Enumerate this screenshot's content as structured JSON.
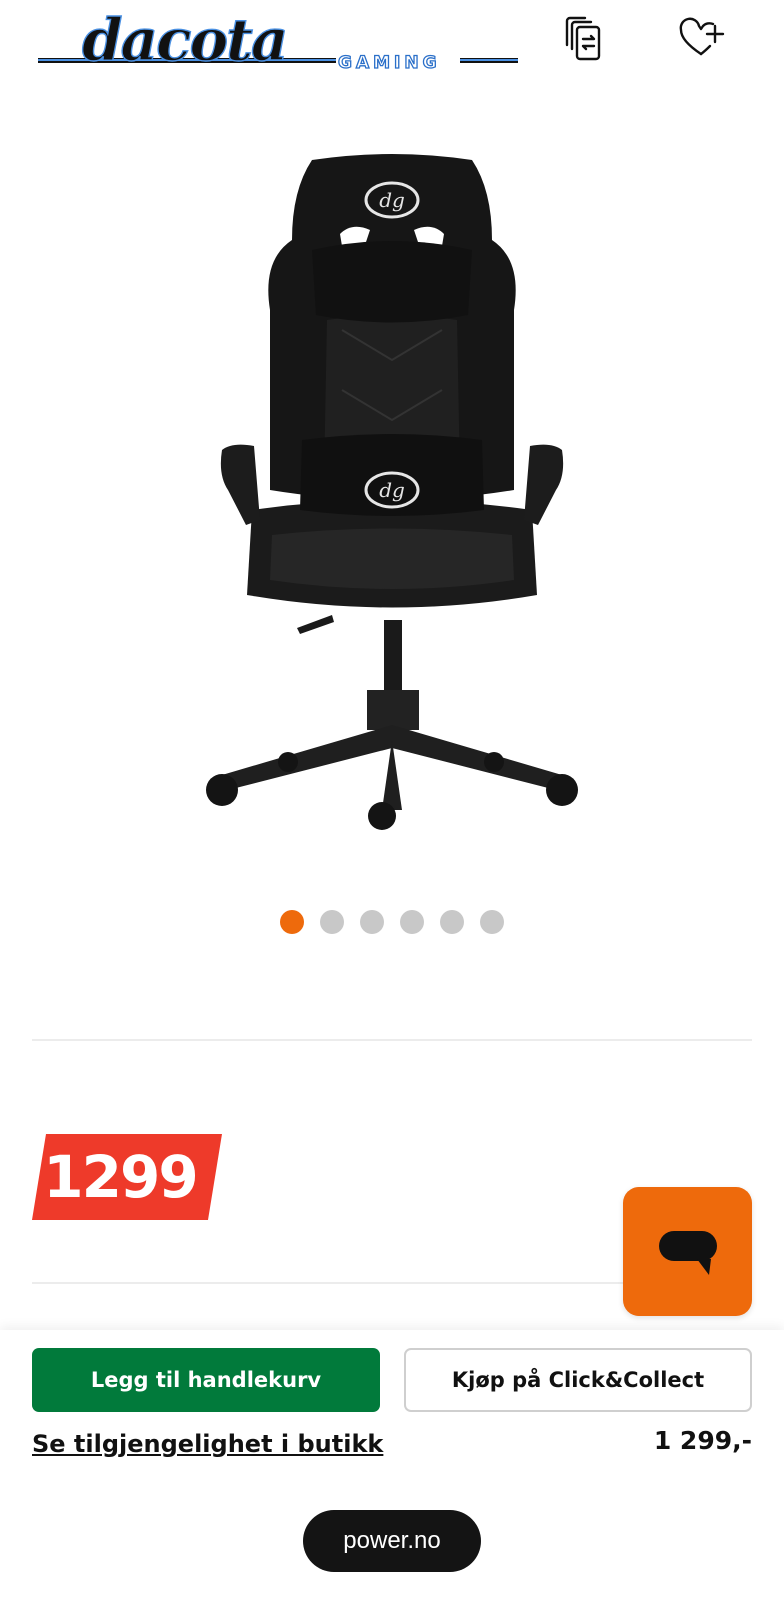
{
  "header": {
    "brand_logo": "dacota GAMING",
    "compare_icon": "compare-icon",
    "wishlist_icon": "heart-plus-icon"
  },
  "gallery": {
    "image": "black gaming chair with dg logo",
    "dot_count": 6,
    "active_index": 0
  },
  "price": {
    "badge": "1299",
    "badge_color": "#ee3a2a"
  },
  "chat": {
    "icon": "chat-bubble-icon",
    "color": "#ee6a0c"
  },
  "actions": {
    "add_to_cart": "Legg til handlekurv",
    "click_collect": "Kjøp på Click&Collect",
    "store_availability": "Se tilgjengelighet i butikk",
    "price": "1 299,-",
    "primary_color": "#017a3b"
  },
  "browser": {
    "url": "power.no"
  }
}
